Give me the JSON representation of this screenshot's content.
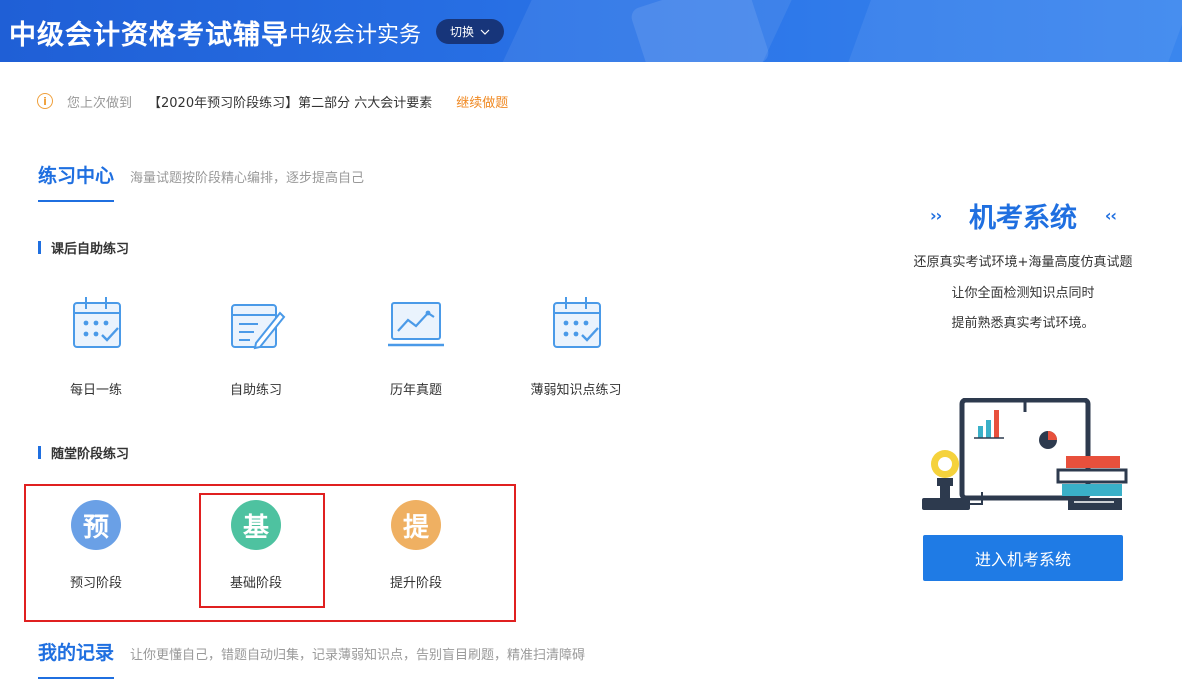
{
  "header": {
    "app_title": "中级会计资格考试辅导",
    "subject": "中级会计实务",
    "switch_label": "切换"
  },
  "notice": {
    "prefix": "您上次做到",
    "exercise": "【2020年预习阶段练习】第二部分 六大会计要素",
    "continue": "继续做题"
  },
  "practice": {
    "title": "练习中心",
    "desc": "海量试题按阶段精心编排，逐步提高自己",
    "after_class": {
      "title": "课后自助练习",
      "items": [
        {
          "label": "每日一练",
          "icon": "daily-calendar-icon"
        },
        {
          "label": "自助练习",
          "icon": "self-practice-icon"
        },
        {
          "label": "历年真题",
          "icon": "past-exams-icon"
        },
        {
          "label": "薄弱知识点练习",
          "icon": "weak-points-icon"
        }
      ]
    },
    "stages": {
      "title": "随堂阶段练习",
      "items": [
        {
          "glyph": "预",
          "label": "预习阶段",
          "color": "#6aa0e6"
        },
        {
          "glyph": "基",
          "label": "基础阶段",
          "color": "#4ec2a0"
        },
        {
          "glyph": "提",
          "label": "提升阶段",
          "color": "#efb062"
        }
      ]
    }
  },
  "records": {
    "title": "我的记录",
    "desc": "让你更懂自己，错题自动归集，记录薄弱知识点，告别盲目刷题，精准扫清障碍"
  },
  "exam": {
    "left_arrows": "››",
    "right_arrows": "‹‹",
    "title": "机考系统",
    "line1": "还原真实考试环境+海量高度仿真试题",
    "line2": "让你全面检测知识点同时",
    "line3": "提前熟悉真实考试环境。",
    "button": "进入机考系统"
  },
  "colors": {
    "accent": "#1f6fe0",
    "orange": "#f08a24",
    "highlight": "#e02020"
  }
}
